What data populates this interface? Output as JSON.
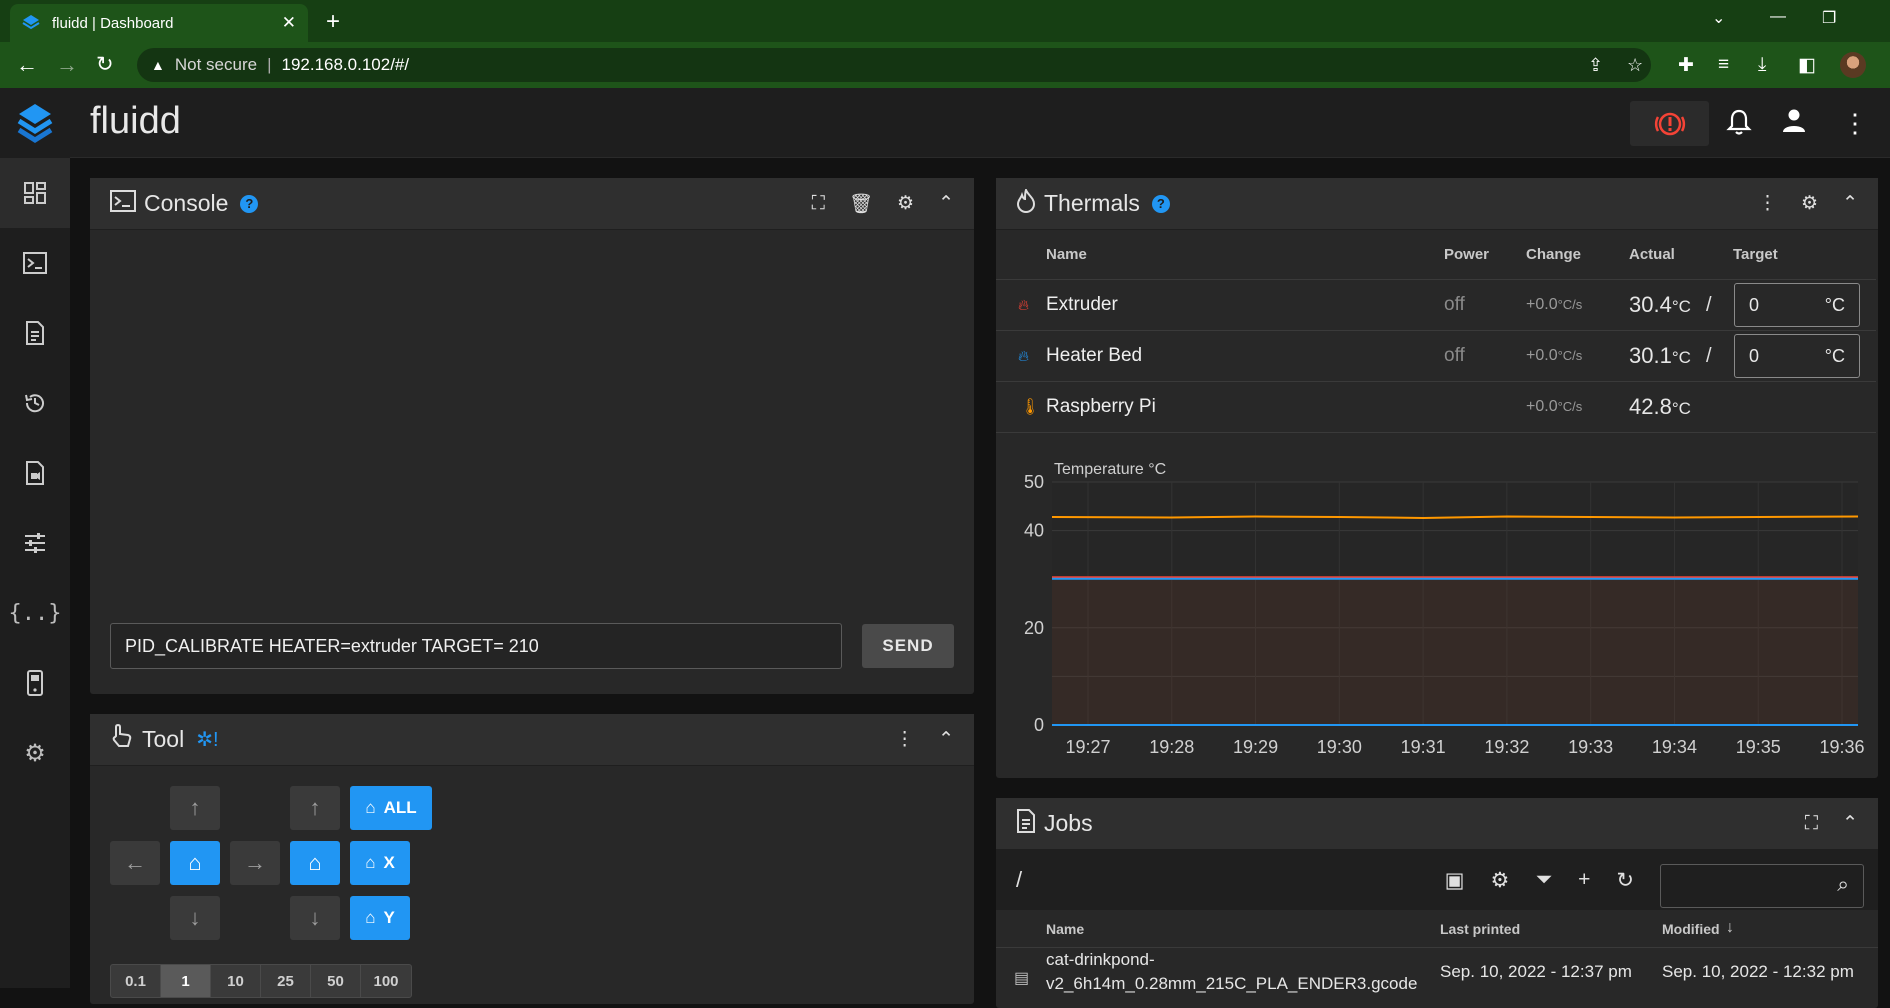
{
  "browser": {
    "tab_title": "fluidd | Dashboard",
    "security_label": "Not secure",
    "url": "192.168.0.102/#/"
  },
  "app": {
    "name": "fluidd"
  },
  "console": {
    "title": "Console",
    "input_value": "PID_CALIBRATE HEATER=extruder TARGET= 210",
    "send_label": "SEND"
  },
  "tool": {
    "title": "Tool",
    "home_all": "ALL",
    "home_x": "X",
    "home_y": "Y",
    "steps": [
      "0.1",
      "1",
      "10",
      "25",
      "50",
      "100"
    ],
    "selected_step": "1"
  },
  "thermals": {
    "title": "Thermals",
    "headers": {
      "name": "Name",
      "power": "Power",
      "change": "Change",
      "actual": "Actual",
      "target": "Target"
    },
    "rows": [
      {
        "name": "Extruder",
        "power": "off",
        "change": "+0.0",
        "change_unit": "°C/s",
        "actual": "30.4",
        "unit": "°C",
        "target": "0",
        "target_unit": "°C",
        "icon": "fire-icon",
        "color": "#f44336"
      },
      {
        "name": "Heater Bed",
        "power": "off",
        "change": "+0.0",
        "change_unit": "°C/s",
        "actual": "30.1",
        "unit": "°C",
        "target": "0",
        "target_unit": "°C",
        "icon": "fire-icon",
        "color": "#2196f3"
      },
      {
        "name": "Raspberry Pi",
        "power": "",
        "change": "+0.0",
        "change_unit": "°C/s",
        "actual": "42.8",
        "unit": "°C",
        "icon": "thermometer-icon",
        "color": "#ff9800"
      }
    ],
    "slash": "/"
  },
  "chart_data": {
    "type": "line",
    "title": "",
    "ylabel": "Temperature °C",
    "xlabel": "",
    "ylim": [
      0,
      50
    ],
    "yticks": [
      0,
      20,
      40,
      50
    ],
    "x": [
      "19:27",
      "19:28",
      "19:29",
      "19:30",
      "19:31",
      "19:32",
      "19:33",
      "19:34",
      "19:35",
      "19:36"
    ],
    "series": [
      {
        "color": "#ff9800",
        "values": [
          42.8,
          42.7,
          42.9,
          42.8,
          42.6,
          42.9,
          42.8,
          42.7,
          42.8,
          42.9
        ]
      },
      {
        "color": "#f44336",
        "values": [
          30.4,
          30.4,
          30.4,
          30.4,
          30.4,
          30.4,
          30.4,
          30.4,
          30.4,
          30.4
        ]
      },
      {
        "color": "#2196f3",
        "values": [
          30.1,
          30.1,
          30.1,
          30.1,
          30.1,
          30.1,
          30.1,
          30.1,
          30.1,
          30.1
        ]
      },
      {
        "color": "#f44336",
        "values": [
          0,
          0,
          0,
          0,
          0,
          0,
          0,
          0,
          0,
          0
        ]
      },
      {
        "color": "#2196f3",
        "values": [
          0,
          0,
          0,
          0,
          0,
          0,
          0,
          0,
          0,
          0
        ]
      }
    ],
    "grid": true,
    "legend": "none"
  },
  "jobs": {
    "title": "Jobs",
    "path": "/",
    "headers": {
      "name": "Name",
      "last_printed": "Last printed",
      "modified": "Modified"
    },
    "rows": [
      {
        "name": "cat-drinkpond-",
        "name2": "v2_6h14m_0.28mm_215C_PLA_ENDER3.gcode",
        "last_printed": "Sep. 10, 2022 - 12:37 pm",
        "modified": "Sep. 10, 2022 - 12:32 pm"
      }
    ]
  },
  "colors": {
    "accent": "#2196f3",
    "danger": "#f44336",
    "warning": "#ff9800"
  }
}
